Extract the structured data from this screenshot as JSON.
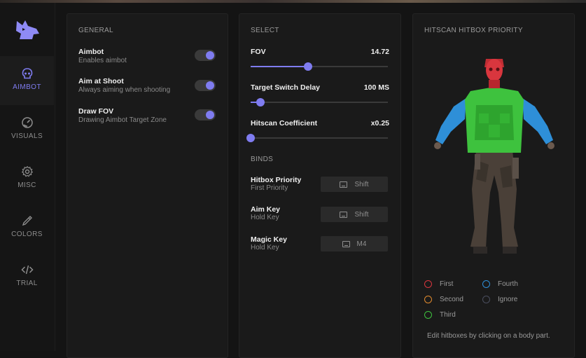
{
  "sidebar": {
    "items": [
      {
        "label": "AIMBOT",
        "icon": "skull-icon",
        "active": true
      },
      {
        "label": "VISUALS",
        "icon": "gauge-icon",
        "active": false
      },
      {
        "label": "MISC",
        "icon": "gear-icon",
        "active": false
      },
      {
        "label": "COLORS",
        "icon": "eyedropper-icon",
        "active": false
      },
      {
        "label": "TRIAL",
        "icon": "code-icon",
        "active": false
      }
    ]
  },
  "general": {
    "title": "GENERAL",
    "options": [
      {
        "name": "Aimbot",
        "desc": "Enables aimbot",
        "enabled": true
      },
      {
        "name": "Aim at Shoot",
        "desc": "Always aiming when shooting",
        "enabled": true
      },
      {
        "name": "Draw FOV",
        "desc": "Drawing Aimbot Target Zone",
        "enabled": true
      }
    ]
  },
  "select": {
    "title": "SELECT",
    "sliders": [
      {
        "label": "FOV",
        "value": "14.72",
        "fraction": 0.42
      },
      {
        "label": "Target Switch Delay",
        "value": "100 MS",
        "fraction": 0.07
      },
      {
        "label": "Hitscan Coefficient",
        "value": "x0.25",
        "fraction": 0.0
      }
    ]
  },
  "binds": {
    "title": "BINDS",
    "items": [
      {
        "name": "Hitbox Priority",
        "sub": "First Priority",
        "key": "Shift"
      },
      {
        "name": "Aim Key",
        "sub": "Hold Key",
        "key": "Shift"
      },
      {
        "name": "Magic Key",
        "sub": "Hold Key",
        "key": "M4"
      }
    ]
  },
  "hitbox": {
    "title": "HITSCAN HITBOX PRIORITY",
    "legend": [
      {
        "label": "First",
        "color": "#d9363e"
      },
      {
        "label": "Fourth",
        "color": "#2e8fd8"
      },
      {
        "label": "Second",
        "color": "#e08a2e"
      },
      {
        "label": "Ignore",
        "color": "#4a4e5e"
      },
      {
        "label": "Third",
        "color": "#3ec23e"
      }
    ],
    "hint": "Edit hitboxes by clicking on a body part."
  },
  "colors": {
    "accent": "#7f7cf0",
    "head": "#d9363e",
    "torso": "#3ec23e",
    "arms": "#2e8fd8"
  }
}
